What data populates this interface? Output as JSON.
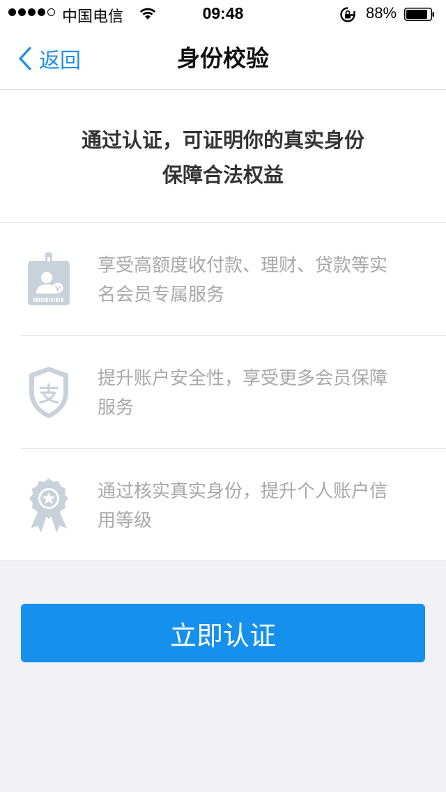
{
  "status_bar": {
    "carrier": "中国电信",
    "time": "09:48",
    "battery_percent": "88%",
    "signal_bars_filled": 4,
    "signal_bars_total": 5,
    "battery_level": 0.88,
    "icons": [
      "signal-icon",
      "wifi-icon",
      "rotation-lock-icon",
      "battery-icon"
    ]
  },
  "nav": {
    "back_label": "返回",
    "title": "身份校验",
    "back_color": "#1f8fe6"
  },
  "headline": {
    "line1": "通过认证，可证明你的真实身份",
    "line2": "保障合法权益"
  },
  "benefits": [
    {
      "icon": "id-badge-icon",
      "line1": "享受高额度收付款、理财、贷款等实",
      "line2": "名会员专属服务"
    },
    {
      "icon": "shield-alipay-icon",
      "line1": "提升账户安全性，享受更多会员保障",
      "line2": "服务"
    },
    {
      "icon": "award-ribbon-icon",
      "line1": "通过核实真实身份，提升个人账户信",
      "line2": "用等级"
    }
  ],
  "cta": {
    "label": "立即认证",
    "color": "#1590ec"
  },
  "colors": {
    "icon_gray": "#c9d2da",
    "benefit_text": "#a8a8ad",
    "background": "#f2f2f6"
  }
}
